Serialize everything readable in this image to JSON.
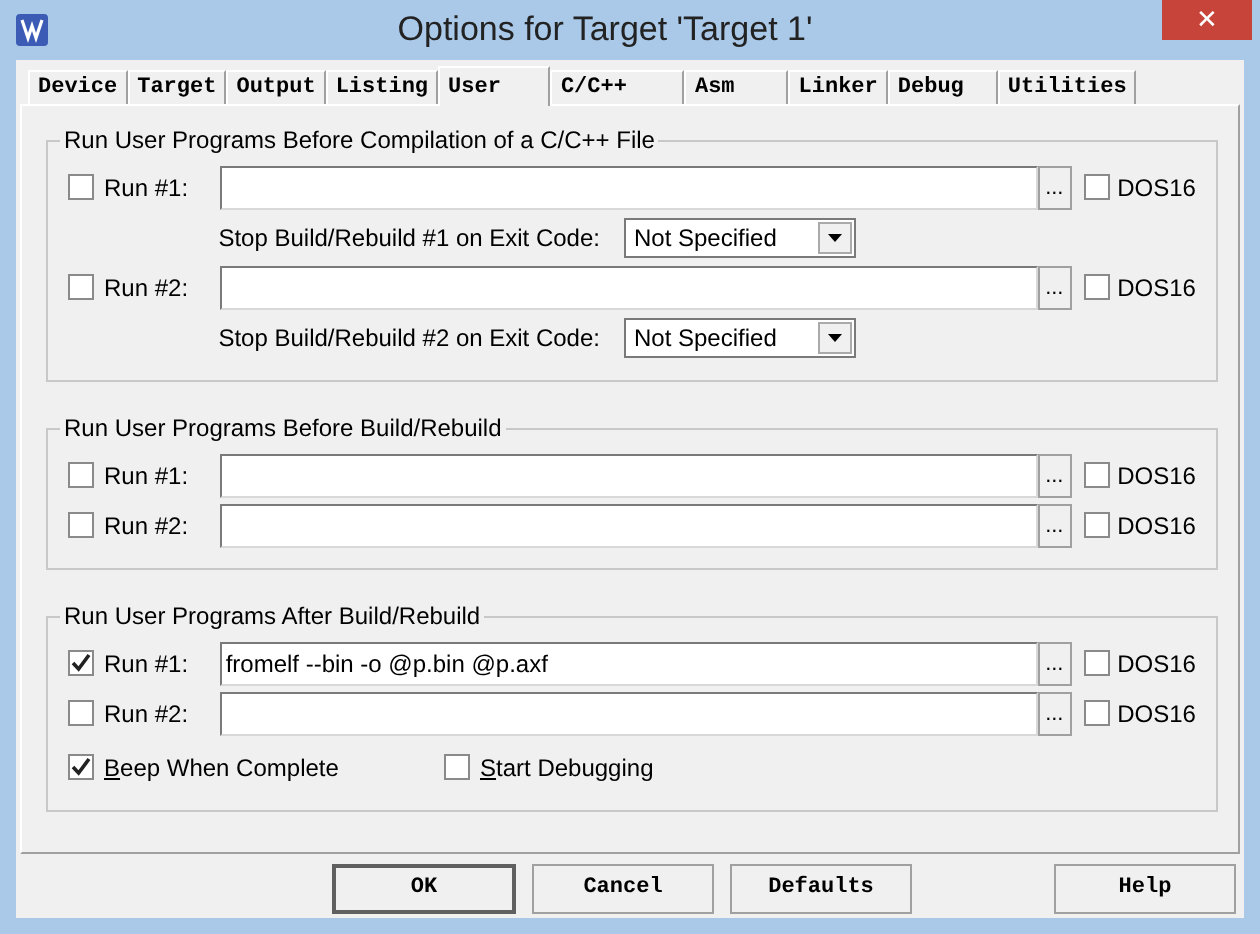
{
  "window": {
    "title": "Options for Target 'Target 1'",
    "close": "✕"
  },
  "tabs": [
    {
      "label": "Device",
      "selected": false
    },
    {
      "label": "Target",
      "selected": false
    },
    {
      "label": "Output",
      "selected": false
    },
    {
      "label": "Listing",
      "selected": false
    },
    {
      "label": "User",
      "selected": true
    },
    {
      "label": "C/C++",
      "selected": false
    },
    {
      "label": "Asm",
      "selected": false
    },
    {
      "label": "Linker",
      "selected": false
    },
    {
      "label": "Debug",
      "selected": false
    },
    {
      "label": "Utilities",
      "selected": false
    }
  ],
  "groups": [
    {
      "title": "Run User Programs Before Compilation of a C/C++ File",
      "rows": [
        {
          "kind": "run",
          "label": "Run #1:",
          "checked": false,
          "browse": "...",
          "dos16": {
            "label": "DOS16",
            "checked": false
          }
        },
        {
          "kind": "exit",
          "label": "Stop Build/Rebuild #1 on Exit Code:",
          "value": "Not Specified"
        },
        {
          "kind": "run",
          "label": "Run #2:",
          "checked": false,
          "browse": "...",
          "dos16": {
            "label": "DOS16",
            "checked": false
          }
        },
        {
          "kind": "exit",
          "label": "Stop Build/Rebuild #2 on Exit Code:",
          "value": "Not Specified"
        }
      ]
    },
    {
      "title": "Run User Programs Before Build/Rebuild",
      "rows": [
        {
          "kind": "run",
          "label": "Run #1:",
          "checked": false,
          "browse": "...",
          "dos16": {
            "label": "DOS16",
            "checked": false
          }
        },
        {
          "kind": "run",
          "label": "Run #2:",
          "checked": false,
          "browse": "...",
          "dos16": {
            "label": "DOS16",
            "checked": false
          }
        }
      ]
    },
    {
      "title": "Run User Programs After Build/Rebuild",
      "rows": [
        {
          "kind": "run",
          "label": "Run #1:",
          "checked": true,
          "value": "fromelf --bin -o @p.bin @p.axf",
          "browse": "...",
          "dos16": {
            "label": "DOS16",
            "checked": false
          }
        },
        {
          "kind": "run",
          "label": "Run #2:",
          "checked": false,
          "browse": "...",
          "dos16": {
            "label": "DOS16",
            "checked": false
          }
        },
        {
          "kind": "options",
          "items": [
            {
              "label": "Beep When Complete",
              "checked": true
            },
            {
              "label": "Start Debugging",
              "checked": false
            }
          ]
        }
      ]
    }
  ],
  "buttons": [
    {
      "label": "OK",
      "default": true
    },
    {
      "label": "Cancel",
      "default": false
    },
    {
      "label": "Defaults",
      "default": false
    },
    {
      "label": "Help",
      "default": false
    }
  ]
}
